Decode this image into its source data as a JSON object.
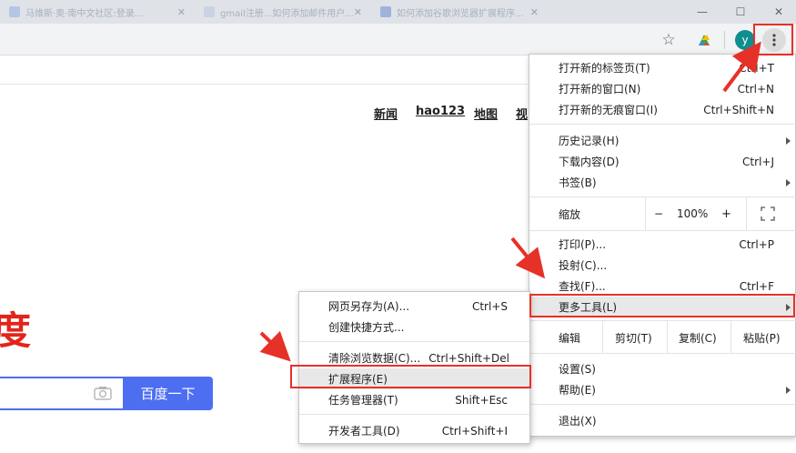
{
  "browser": {
    "tabs": [
      {
        "title": "马维斯·奥·南中文社区:登录..."
      },
      {
        "title": "gmail注册...如何添加邮件用户..."
      },
      {
        "title": "如何添加谷歌浏览器扩展程序..."
      }
    ],
    "avatar_letter": "y"
  },
  "page": {
    "nav_links": [
      "新闻",
      "hao123",
      "地图",
      "视"
    ],
    "logo_fragment": "度",
    "search_button": "百度一下"
  },
  "chrome_menu": {
    "items": [
      {
        "label": "打开新的标签页(T)",
        "shortcut": "Ctrl+T"
      },
      {
        "label": "打开新的窗口(N)",
        "shortcut": "Ctrl+N"
      },
      {
        "label": "打开新的无痕窗口(I)",
        "shortcut": "Ctrl+Shift+N"
      },
      {
        "label": "历史记录(H)",
        "shortcut": ""
      },
      {
        "label": "下载内容(D)",
        "shortcut": "Ctrl+J"
      },
      {
        "label": "书签(B)",
        "shortcut": ""
      },
      {
        "label": "打印(P)...",
        "shortcut": "Ctrl+P"
      },
      {
        "label": "投射(C)...",
        "shortcut": ""
      },
      {
        "label": "查找(F)...",
        "shortcut": "Ctrl+F"
      },
      {
        "label": "更多工具(L)",
        "shortcut": ""
      },
      {
        "label": "设置(S)",
        "shortcut": ""
      },
      {
        "label": "帮助(E)",
        "shortcut": ""
      },
      {
        "label": "退出(X)",
        "shortcut": ""
      }
    ],
    "zoom": {
      "label": "缩放",
      "minus": "−",
      "value": "100%",
      "plus": "+"
    },
    "edit": {
      "label": "编辑",
      "cut": "剪切(T)",
      "copy": "复制(C)",
      "paste": "粘贴(P)"
    }
  },
  "more_tools_menu": {
    "items": [
      {
        "label": "网页另存为(A)...",
        "shortcut": "Ctrl+S"
      },
      {
        "label": "创建快捷方式...",
        "shortcut": ""
      },
      {
        "label": "清除浏览数据(C)...",
        "shortcut": "Ctrl+Shift+Del"
      },
      {
        "label": "扩展程序(E)",
        "shortcut": ""
      },
      {
        "label": "任务管理器(T)",
        "shortcut": "Shift+Esc"
      },
      {
        "label": "开发者工具(D)",
        "shortcut": "Ctrl+Shift+I"
      }
    ]
  },
  "colors": {
    "highlight_red": "#e63129",
    "baidu_blue": "#4e6ef2",
    "baidu_red": "#e1251b"
  }
}
